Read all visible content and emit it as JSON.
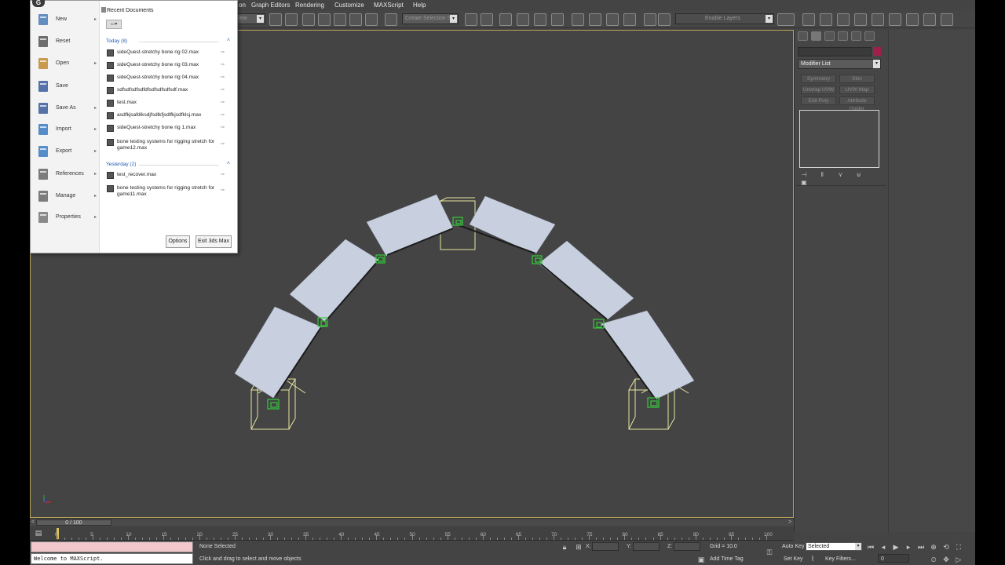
{
  "menubar": {
    "items": [
      "on",
      "Graph Editors",
      "Rendering",
      "Customize",
      "MAXScript",
      "Help"
    ]
  },
  "toolbar": {
    "view_dropdown": "iew",
    "selection_set": "Create Selection Se",
    "layer_dropdown": "Enable Layers"
  },
  "app_menu": {
    "logo": "G",
    "items": [
      {
        "label": "New",
        "icon": "new-icon",
        "has_sub": true
      },
      {
        "label": "Reset",
        "icon": "reset-icon",
        "has_sub": false
      },
      {
        "label": "Open",
        "icon": "open-icon",
        "has_sub": true
      },
      {
        "label": "Save",
        "icon": "save-icon",
        "has_sub": false
      },
      {
        "label": "Save As",
        "icon": "save-as-icon",
        "has_sub": true
      },
      {
        "label": "Import",
        "icon": "import-icon",
        "has_sub": true
      },
      {
        "label": "Export",
        "icon": "export-icon",
        "has_sub": true
      },
      {
        "label": "References",
        "icon": "references-icon",
        "has_sub": true
      },
      {
        "label": "Manage",
        "icon": "manage-icon",
        "has_sub": true
      },
      {
        "label": "Properties",
        "icon": "properties-icon",
        "has_sub": true
      }
    ],
    "sub_arrow": "▸",
    "recent_title": "Recent Documents",
    "view_toggle": "▭▾",
    "groups": [
      {
        "label": "Today (8)",
        "files": [
          "sideQuest-stretchy bone rig 02.max",
          "sideQuest-stretchy bone rig 03.max",
          "sideQuest-stretchy bone rig 04.max",
          "sdfsdfsdfsdfdfsdfsdfsdfsdf.max",
          "test.max",
          "asdfkjsafdiksdjfsdlkfjsdlfkjsdfklsj.max",
          "sideQuest-stretchy bone rig 1.max",
          "bone testing systems for rigging stretch for game12.max"
        ]
      },
      {
        "label": "Yesterday (2)",
        "files": [
          "test_recover.max",
          "bone testing systems for rigging stretch for game11.max"
        ]
      }
    ],
    "pin_glyph": "⊸",
    "collapse_glyph": "˄",
    "options_label": "Options",
    "exit_label": "Exit 3ds Max"
  },
  "command_panel": {
    "modifier_list": "Modifier List",
    "color_swatch": "#a0204a",
    "modifier_buttons": [
      "Symmetry",
      "Skin",
      "Unwrap UVW",
      "UVW Map",
      "Edit Poly",
      "Attribute Holder"
    ],
    "stack_tools": [
      "⊣",
      "‖",
      "⋎",
      "⊍",
      "▣"
    ]
  },
  "timeline": {
    "frame_counter": "0 / 100",
    "left_arrow": "<",
    "right_arrow": ">",
    "ticks": [
      "0",
      "5",
      "10",
      "15",
      "20",
      "25",
      "30",
      "35",
      "40",
      "45",
      "50",
      "55",
      "60",
      "65",
      "70",
      "75",
      "80",
      "85",
      "90",
      "95",
      "100"
    ]
  },
  "status": {
    "maxscript_output": "",
    "maxscript_listener": "Welcome to MAXScript.",
    "selection": "None Selected",
    "prompt": "Click and drag to select and move objects",
    "x_label": "X:",
    "y_label": "Y:",
    "z_label": "Z:",
    "grid": "Grid = 10.0",
    "add_time_tag": "Add Time Tag",
    "auto_key": "Auto Key",
    "set_key": "Set Key",
    "selected_dropdown": "Selected",
    "key_filters": "Key Filters...",
    "current_frame": "0"
  },
  "colors": {
    "viewport_bg": "#444444",
    "plane_fill": "#c8d0e0",
    "bone_green": "#36c93a",
    "bbox_yellow": "#e8e6a0"
  }
}
